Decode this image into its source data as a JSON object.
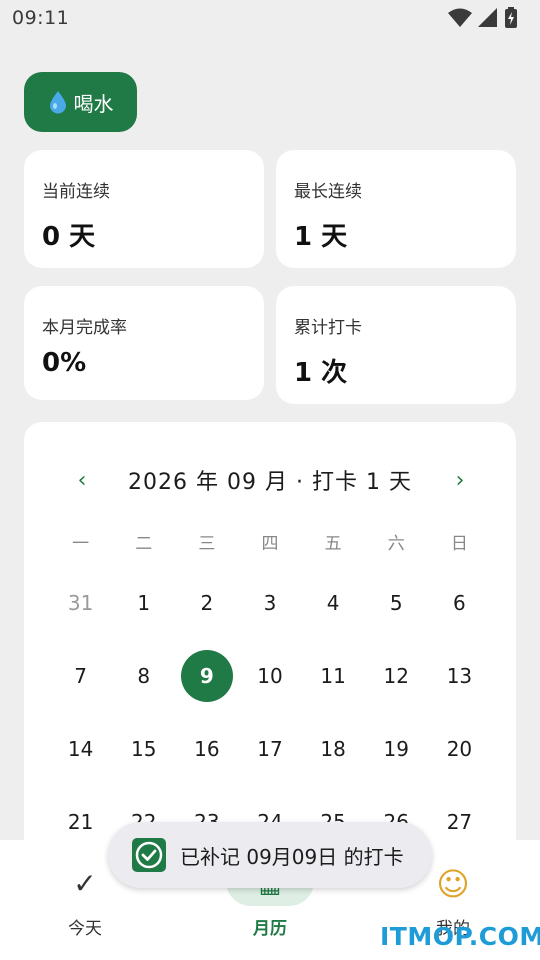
{
  "status_bar": {
    "time": "09:11",
    "icons": [
      "wifi-icon",
      "cellular-signal-icon",
      "battery-charging-icon"
    ]
  },
  "habit": {
    "name": "喝水",
    "icon": "water-drop-icon"
  },
  "stats": {
    "current_streak": {
      "label": "当前连续",
      "value": "0 天"
    },
    "longest_streak": {
      "label": "最长连续",
      "value": "1 天"
    },
    "month_completion": {
      "label": "本月完成率",
      "value": "0%"
    },
    "total_checkins": {
      "label": "累计打卡",
      "value": "1 次"
    }
  },
  "calendar": {
    "title": "2026 年 09 月 · 打卡 1 天",
    "prev_label": "‹",
    "next_label": "›",
    "weekdays": [
      "一",
      "二",
      "三",
      "四",
      "五",
      "六",
      "日"
    ],
    "weeks": [
      [
        {
          "d": "31",
          "muted": true
        },
        {
          "d": "1"
        },
        {
          "d": "2"
        },
        {
          "d": "3"
        },
        {
          "d": "4"
        },
        {
          "d": "5"
        },
        {
          "d": "6"
        }
      ],
      [
        {
          "d": "7"
        },
        {
          "d": "8"
        },
        {
          "d": "9",
          "selected": true
        },
        {
          "d": "10"
        },
        {
          "d": "11"
        },
        {
          "d": "12"
        },
        {
          "d": "13"
        }
      ],
      [
        {
          "d": "14"
        },
        {
          "d": "15"
        },
        {
          "d": "16"
        },
        {
          "d": "17"
        },
        {
          "d": "18"
        },
        {
          "d": "19"
        },
        {
          "d": "20"
        }
      ],
      [
        {
          "d": "21"
        },
        {
          "d": "22"
        },
        {
          "d": "23"
        },
        {
          "d": "24"
        },
        {
          "d": "25"
        },
        {
          "d": "26"
        },
        {
          "d": "27"
        }
      ]
    ]
  },
  "bottom_nav": {
    "items": [
      {
        "label": "今天",
        "icon": "check-icon",
        "glyph": "✓",
        "active": false
      },
      {
        "label": "月历",
        "icon": "calendar-icon",
        "glyph": "▦",
        "active": true
      },
      {
        "label": "我的",
        "icon": "smiley-icon",
        "glyph": "☺",
        "active": false
      }
    ]
  },
  "toast": {
    "text": "已补记 09月09日 的打卡",
    "icon": "checkbox-checked-icon"
  },
  "watermark": {
    "text": "ITMOP.COM"
  },
  "colors": {
    "accent": "#1f7a45",
    "background": "#eeeeee",
    "card": "#ffffff",
    "watermark": "#1e9cd7"
  }
}
